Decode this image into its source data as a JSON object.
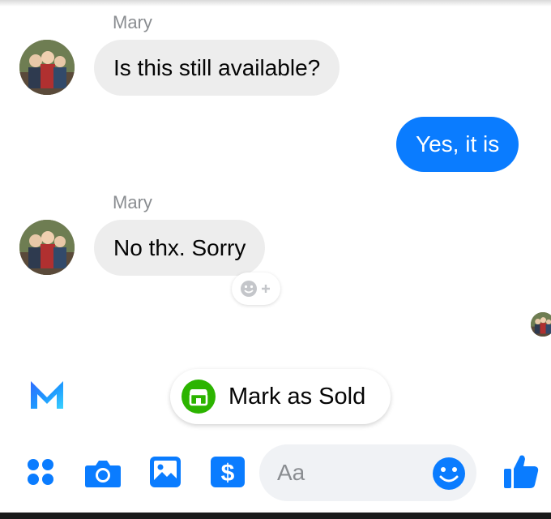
{
  "conversation": {
    "messages": [
      {
        "sender": "Mary",
        "text": "Is this still available?",
        "direction": "incoming"
      },
      {
        "sender": "",
        "text": "Yes, it is",
        "direction": "outgoing"
      },
      {
        "sender": "Mary",
        "text": "No thx.  Sorry",
        "direction": "incoming"
      }
    ]
  },
  "reaction": {
    "icon": "add-reaction-icon"
  },
  "suggestion": {
    "label": "Mark as Sold",
    "icon": "storefront-icon"
  },
  "assistant": {
    "icon": "meta-m-logo"
  },
  "composer": {
    "placeholder": "Aa",
    "value": "",
    "buttons": [
      "more-apps-icon",
      "camera-icon",
      "gallery-icon",
      "payment-icon",
      "emoji-icon",
      "thumbs-up-icon"
    ]
  },
  "colors": {
    "outgoing_bubble": "#0a7cff",
    "incoming_bubble": "#ededed",
    "accent": "#0a7cff",
    "sold_green": "#2cb400"
  }
}
